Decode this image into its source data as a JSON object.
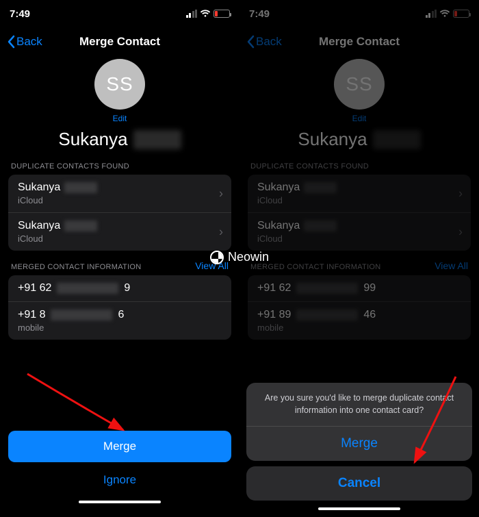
{
  "status": {
    "time": "7:49"
  },
  "nav": {
    "back": "Back",
    "title": "Merge Contact"
  },
  "avatar": {
    "initials": "SS",
    "edit": "Edit"
  },
  "contact": {
    "first_name": "Sukanya"
  },
  "sections": {
    "dup_header": "DUPLICATE CONTACTS FOUND",
    "merged_header": "MERGED CONTACT INFORMATION",
    "view_all": "View All"
  },
  "duplicates": [
    {
      "name": "Sukanya",
      "source": "iCloud"
    },
    {
      "name": "Sukanya",
      "source": "iCloud"
    }
  ],
  "merged": [
    {
      "prefix": "+91 62",
      "suffix": "9",
      "label": ""
    },
    {
      "prefix": "+91 8",
      "suffix": "6",
      "label": "mobile"
    }
  ],
  "merged_right": [
    {
      "prefix": "+91 62",
      "suffix": "99",
      "label": ""
    },
    {
      "prefix": "+91 89",
      "suffix": "46",
      "label": "mobile"
    }
  ],
  "buttons": {
    "merge": "Merge",
    "ignore": "Ignore"
  },
  "sheet": {
    "message": "Are you sure you'd like to merge duplicate contact information into one contact card?",
    "merge": "Merge",
    "cancel": "Cancel"
  },
  "watermark": "Neowin"
}
